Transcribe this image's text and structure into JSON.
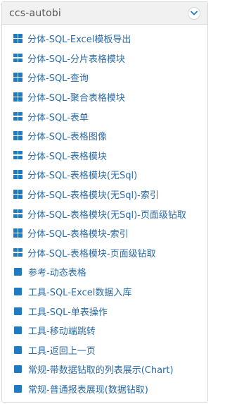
{
  "panel": {
    "title": "ccs-autobi",
    "collapse_icon": "chevron-down-icon",
    "accent": "#1f7ac2",
    "link_color": "#2b6ba6"
  },
  "items": [
    {
      "label": "分体-SQL-Excel模板导出",
      "icon": "grid-icon"
    },
    {
      "label": "分体-SQL-分片表格模块",
      "icon": "grid-icon"
    },
    {
      "label": "分体-SQL-查询",
      "icon": "grid-icon"
    },
    {
      "label": "分体-SQL-聚合表格模块",
      "icon": "grid-icon"
    },
    {
      "label": "分体-SQL-表单",
      "icon": "grid-icon"
    },
    {
      "label": "分体-SQL-表格图像",
      "icon": "grid-icon"
    },
    {
      "label": "分体-SQL-表格模块",
      "icon": "grid-icon"
    },
    {
      "label": "分体-SQL-表格模块(无Sql)",
      "icon": "grid-icon"
    },
    {
      "label": "分体-SQL-表格模块(无Sql)-索引",
      "icon": "grid-icon"
    },
    {
      "label": "分体-SQL-表格模块(无Sql)-页面级钻取",
      "icon": "grid-icon"
    },
    {
      "label": "分体-SQL-表格模块-索引",
      "icon": "grid-icon"
    },
    {
      "label": "分体-SQL-表格模块-页面级钻取",
      "icon": "grid-icon"
    },
    {
      "label": "参考-动态表格",
      "icon": "square-icon"
    },
    {
      "label": "工具-SQL-Excel数据入库",
      "icon": "square-icon"
    },
    {
      "label": "工具-SQL-单表操作",
      "icon": "square-icon"
    },
    {
      "label": "工具-移动端跳转",
      "icon": "square-icon"
    },
    {
      "label": "工具-返回上一页",
      "icon": "square-icon"
    },
    {
      "label": "常规-带数据钻取的列表展示(Chart)",
      "icon": "square-icon"
    },
    {
      "label": "常规-普通报表展现(数据钻取)",
      "icon": "square-icon"
    }
  ]
}
